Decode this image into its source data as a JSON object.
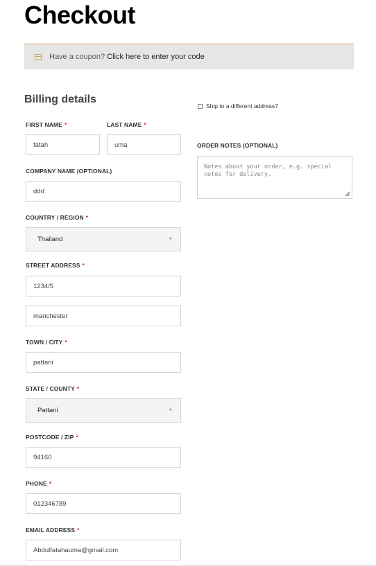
{
  "page": {
    "title": "Checkout"
  },
  "coupon": {
    "icon": "coupon-icon",
    "prompt": "Have a coupon?",
    "link": "Click here to enter your code"
  },
  "billing": {
    "title": "Billing details",
    "required_mark": "*",
    "first_name": {
      "label": "FIRST NAME",
      "value": "fatah"
    },
    "last_name": {
      "label": "LAST NAME",
      "value": "uma"
    },
    "company": {
      "label": "COMPANY NAME (OPTIONAL)",
      "value": "ddd"
    },
    "country": {
      "label": "COUNTRY / REGION",
      "value": "Thailand"
    },
    "street": {
      "label": "STREET ADDRESS",
      "value1": "1234/5",
      "value2": "manchester"
    },
    "city": {
      "label": "TOWN / CITY",
      "value": "pattani"
    },
    "state": {
      "label": "STATE / COUNTY",
      "value": "Pattani"
    },
    "postcode": {
      "label": "POSTCODE / ZIP",
      "value": "94160"
    },
    "phone": {
      "label": "PHONE",
      "value": "012346789"
    },
    "email": {
      "label": "EMAIL ADDRESS",
      "value": "Abdulfatahauma@gmail.com"
    }
  },
  "shipping": {
    "ship_different": "Ship to a different address?",
    "order_notes_label": "ORDER NOTES (OPTIONAL)",
    "order_notes_placeholder": "Notes about your order, e.g. special notes for delivery."
  },
  "colors": {
    "accent": "#c9a45c",
    "required": "#c0392b",
    "coupon_bg": "#e6e6e6"
  }
}
